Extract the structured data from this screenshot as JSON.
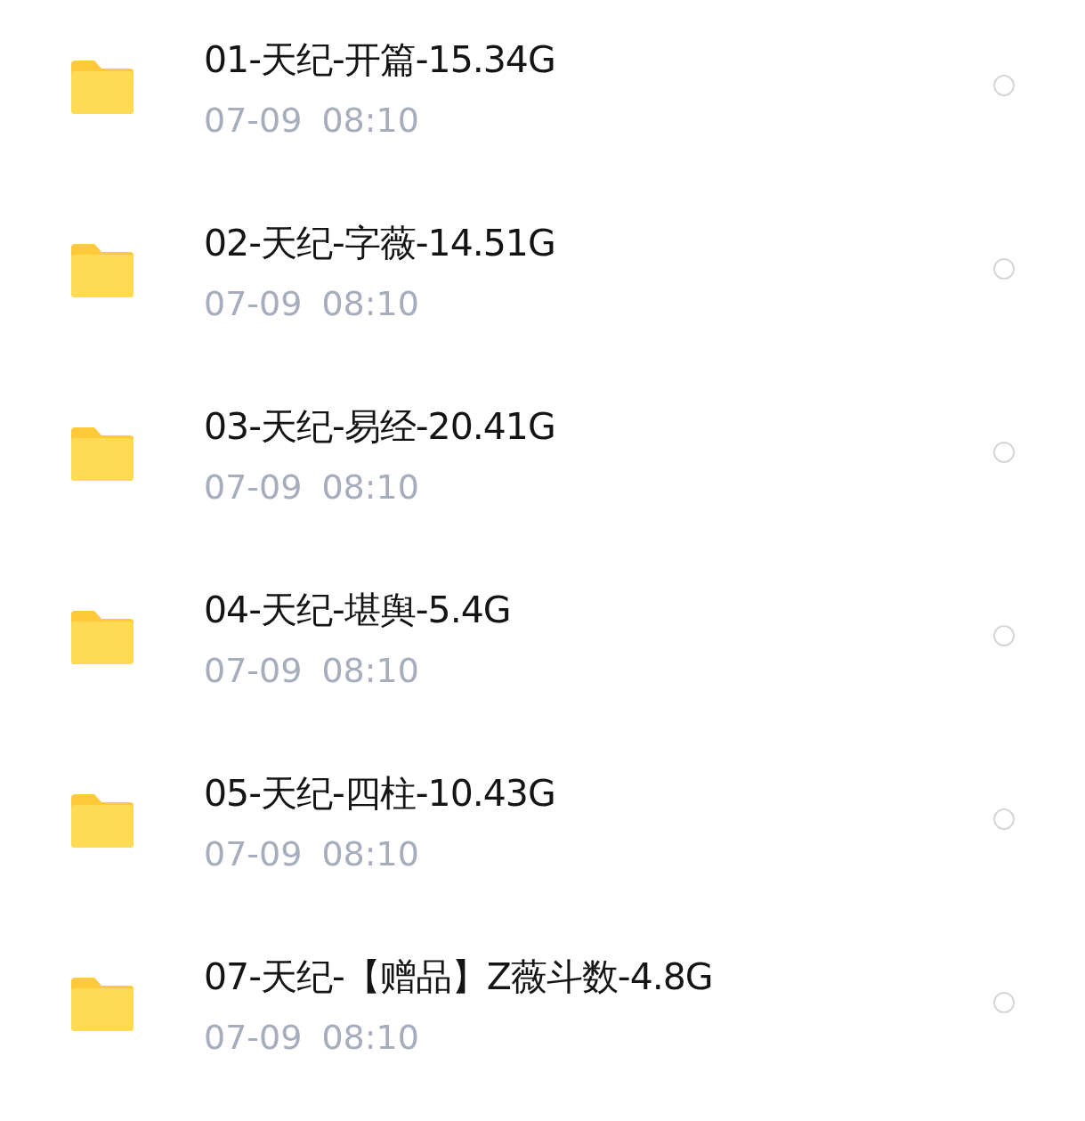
{
  "files": [
    {
      "name": "01-天纪-开篇-15.34G",
      "date": "07-09",
      "time": "08:10",
      "selected": false
    },
    {
      "name": "02-天纪-字薇-14.51G",
      "date": "07-09",
      "time": "08:10",
      "selected": false
    },
    {
      "name": "03-天纪-易经-20.41G",
      "date": "07-09",
      "time": "08:10",
      "selected": false
    },
    {
      "name": "04-天纪-堪舆-5.4G",
      "date": "07-09",
      "time": "08:10",
      "selected": false
    },
    {
      "name": "05-天纪-四柱-10.43G",
      "date": "07-09",
      "time": "08:10",
      "selected": false
    },
    {
      "name": "07-天纪-【赠品】Z薇斗数-4.8G",
      "date": "07-09",
      "time": "08:10",
      "selected": false
    }
  ]
}
